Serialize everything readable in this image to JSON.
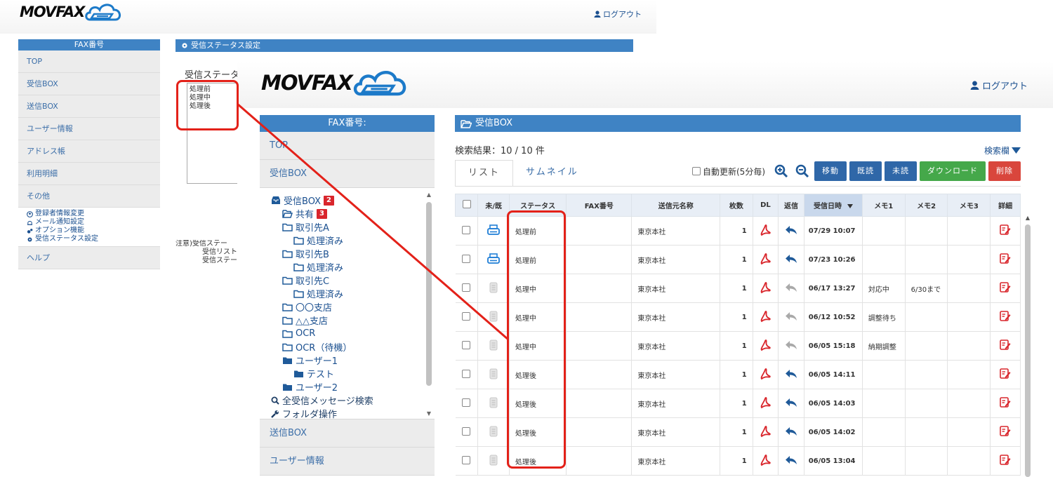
{
  "brand": {
    "name": "MOVFAX"
  },
  "back": {
    "logout": "ログアウト",
    "sidebar": {
      "header": "FAX番号",
      "items": [
        "TOP",
        "受信BOX",
        "送信BOX",
        "ユーザー情報",
        "アドレス帳",
        "利用明細",
        "その他"
      ],
      "sub_items": [
        {
          "icon": "user-circle-icon",
          "label": "登録者情報変更"
        },
        {
          "icon": "bell-icon",
          "label": "メール通知設定"
        },
        {
          "icon": "gears-icon",
          "label": "オプション機能"
        },
        {
          "icon": "gear-icon",
          "label": "受信ステータス設定"
        }
      ],
      "help": "ヘルプ"
    },
    "section_title": "受信ステータス設定",
    "status_label": "受信ステータス",
    "status_values": [
      "処理前",
      "処理中",
      "処理後"
    ],
    "note": [
      "注意)受信ステー",
      "受信リスト",
      "受信ステー"
    ]
  },
  "front": {
    "logout": "ログアウト",
    "sidebar": {
      "header": "FAX番号:",
      "top": "TOP",
      "inbox": "受信BOX",
      "tree": [
        {
          "level": 0,
          "icon": "inbox-icon",
          "label": "受信BOX",
          "badge": "2"
        },
        {
          "level": 1,
          "icon": "folder-open-icon",
          "label": "共有",
          "badge": "3"
        },
        {
          "level": 1,
          "icon": "folder-icon",
          "label": "取引先A",
          "badge": ""
        },
        {
          "level": 2,
          "icon": "folder-icon",
          "label": "処理済み",
          "badge": ""
        },
        {
          "level": 1,
          "icon": "folder-icon",
          "label": "取引先B",
          "badge": ""
        },
        {
          "level": 2,
          "icon": "folder-icon",
          "label": "処理済み",
          "badge": ""
        },
        {
          "level": 1,
          "icon": "folder-icon",
          "label": "取引先C",
          "badge": ""
        },
        {
          "level": 2,
          "icon": "folder-icon",
          "label": "処理済み",
          "badge": ""
        },
        {
          "level": 1,
          "icon": "folder-icon",
          "label": "〇〇支店",
          "badge": ""
        },
        {
          "level": 1,
          "icon": "folder-icon",
          "label": "△△支店",
          "badge": ""
        },
        {
          "level": 1,
          "icon": "folder-icon",
          "label": "OCR",
          "badge": ""
        },
        {
          "level": 1,
          "icon": "folder-icon",
          "label": "OCR（待機）",
          "badge": ""
        },
        {
          "level": 1,
          "icon": "folder-solid-icon",
          "label": "ユーザー1",
          "badge": ""
        },
        {
          "level": 2,
          "icon": "folder-solid-icon",
          "label": "テスト",
          "badge": ""
        },
        {
          "level": 1,
          "icon": "folder-solid-icon",
          "label": "ユーザー2",
          "badge": ""
        },
        {
          "level": 0,
          "icon": "search-icon",
          "label": "全受信メッセージ検索",
          "badge": ""
        },
        {
          "level": 0,
          "icon": "wrench-icon",
          "label": "フォルダ操作",
          "badge": ""
        }
      ],
      "outbox": "送信BOX",
      "user_info": "ユーザー情報"
    },
    "main": {
      "title": "受信BOX",
      "result_text": "検索結果：10 / 10 件",
      "search_toggle": "検索欄",
      "tabs": [
        "リスト",
        "サムネイル"
      ],
      "auto_refresh": "自動更新(5分毎)",
      "buttons": {
        "move": "移動",
        "read": "既読",
        "unread": "未読",
        "download": "ダウンロード",
        "delete": "削除"
      },
      "columns": [
        "",
        "未/既",
        "ステータス",
        "FAX番号",
        "送信元名称",
        "枚数",
        "DL",
        "返信",
        "受信日時",
        "メモ1",
        "メモ2",
        "メモ3",
        "詳細"
      ],
      "rows": [
        {
          "unread": true,
          "status": "処理前",
          "fax": "",
          "sender": "東京本社",
          "pages": "1",
          "reply_active": true,
          "date": "07/29 10:07",
          "memo1": "",
          "memo2": "",
          "memo3": ""
        },
        {
          "unread": true,
          "status": "処理前",
          "fax": "",
          "sender": "東京本社",
          "pages": "1",
          "reply_active": true,
          "date": "07/23 10:26",
          "memo1": "",
          "memo2": "",
          "memo3": ""
        },
        {
          "unread": false,
          "status": "処理中",
          "fax": "",
          "sender": "東京本社",
          "pages": "1",
          "reply_active": false,
          "date": "06/17 13:27",
          "memo1": "対応中",
          "memo2": "6/30まで",
          "memo3": ""
        },
        {
          "unread": false,
          "status": "処理中",
          "fax": "",
          "sender": "東京本社",
          "pages": "1",
          "reply_active": false,
          "date": "06/12 10:52",
          "memo1": "調整待ち",
          "memo2": "",
          "memo3": ""
        },
        {
          "unread": false,
          "status": "処理中",
          "fax": "",
          "sender": "東京本社",
          "pages": "1",
          "reply_active": false,
          "date": "06/05 15:18",
          "memo1": "納期調整",
          "memo2": "",
          "memo3": ""
        },
        {
          "unread": false,
          "status": "処理後",
          "fax": "",
          "sender": "東京本社",
          "pages": "1",
          "reply_active": true,
          "date": "06/05 14:11",
          "memo1": "",
          "memo2": "",
          "memo3": ""
        },
        {
          "unread": false,
          "status": "処理後",
          "fax": "",
          "sender": "東京本社",
          "pages": "1",
          "reply_active": true,
          "date": "06/05 14:03",
          "memo1": "",
          "memo2": "",
          "memo3": ""
        },
        {
          "unread": false,
          "status": "処理後",
          "fax": "",
          "sender": "東京本社",
          "pages": "1",
          "reply_active": true,
          "date": "06/05 14:02",
          "memo1": "",
          "memo2": "",
          "memo3": ""
        },
        {
          "unread": false,
          "status": "処理後",
          "fax": "",
          "sender": "東京本社",
          "pages": "1",
          "reply_active": true,
          "date": "06/05 13:04",
          "memo1": "",
          "memo2": "",
          "memo3": ""
        }
      ]
    }
  },
  "colors": {
    "accent_blue": "#3f83c4",
    "button_blue": "#2f67a8",
    "button_green": "#45a84a",
    "button_red": "#d9463c",
    "badge_red": "#d9262c",
    "annotation_red": "#e32119",
    "pdf_red": "#d9262c",
    "reply_blue": "#1f5a99"
  }
}
